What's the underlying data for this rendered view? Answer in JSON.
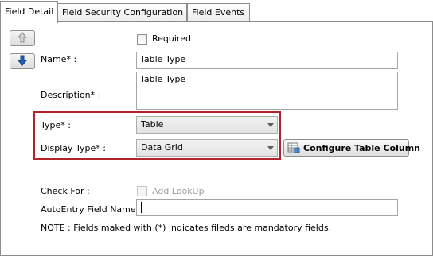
{
  "tabs": [
    {
      "label": "Field Detail"
    },
    {
      "label": "Field Security Configuration"
    },
    {
      "label": "Field Events"
    }
  ],
  "form": {
    "required_label": "Required",
    "name_label": "Name* :",
    "name_value": "Table Type",
    "description_label": "Description* :",
    "description_value": "Table Type",
    "type_label": "Type* :",
    "type_value": "Table",
    "display_type_label": "Display Type* :",
    "display_type_value": "Data Grid",
    "configure_button": "Configure Table Column",
    "check_for_label": "Check For :",
    "add_lookup_label": "Add LookUp",
    "autoentry_label": "AutoEntry Field Name :",
    "autoentry_value": "",
    "note": "NOTE : Fields maked with (*) indicates fileds are mandatory fields."
  },
  "colors": {
    "highlight_border": "#b3232b",
    "arrow_icon": "#1f5fb5"
  },
  "icons": {
    "move_up": "arrow-up-icon",
    "move_down": "arrow-down-icon",
    "configure": "table-config-icon",
    "dropdown": "chevron-down-icon"
  }
}
